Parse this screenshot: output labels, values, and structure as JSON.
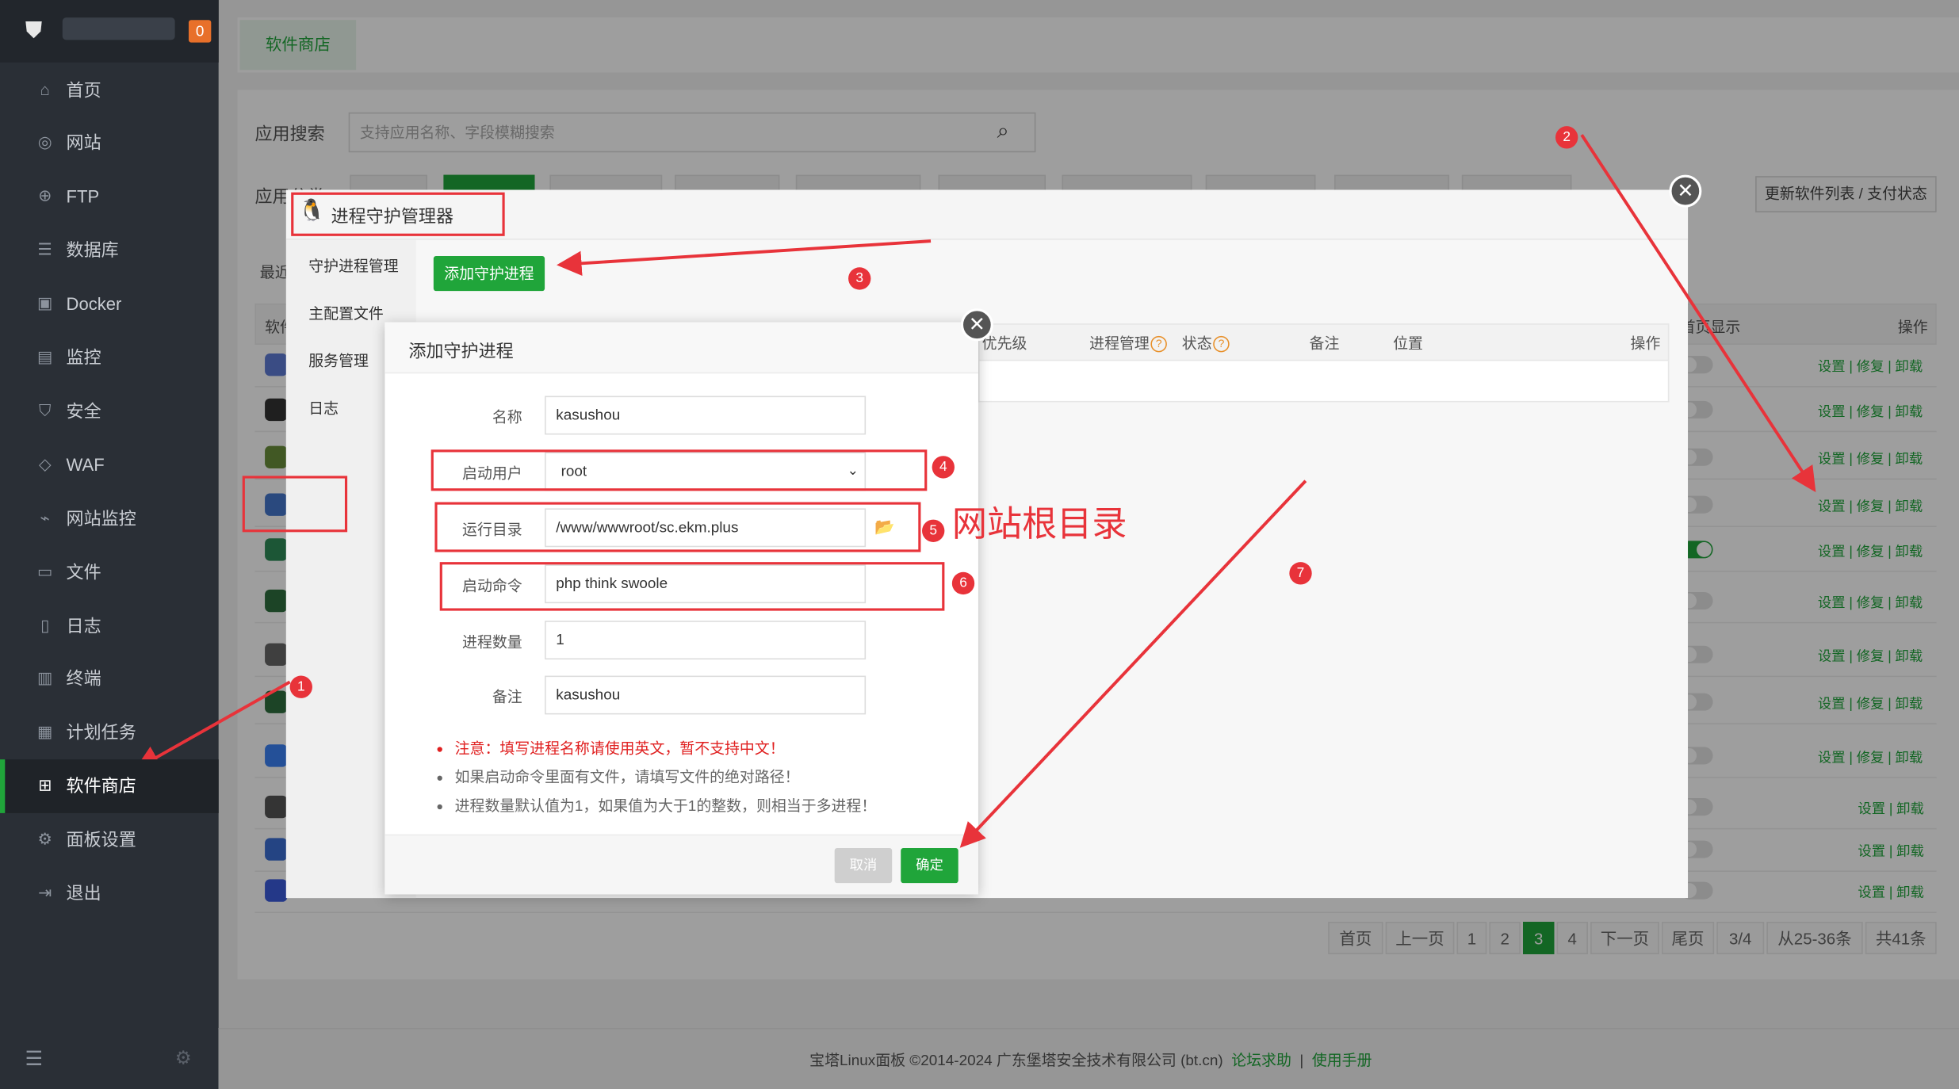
{
  "sidebar": {
    "badge": "0",
    "items": [
      {
        "label": "首页",
        "icon": "home-icon",
        "glyph": "⌂"
      },
      {
        "label": "网站",
        "icon": "globe-icon",
        "glyph": "◎"
      },
      {
        "label": "FTP",
        "icon": "ftp-icon",
        "glyph": "⊕"
      },
      {
        "label": "数据库",
        "icon": "database-icon",
        "glyph": "☰"
      },
      {
        "label": "Docker",
        "icon": "docker-icon",
        "glyph": "▣"
      },
      {
        "label": "监控",
        "icon": "monitor-icon",
        "glyph": "▤"
      },
      {
        "label": "安全",
        "icon": "shield-icon",
        "glyph": "⛉"
      },
      {
        "label": "WAF",
        "icon": "waf-icon",
        "glyph": "◇"
      },
      {
        "label": "网站监控",
        "icon": "chart-icon",
        "glyph": "⌁"
      },
      {
        "label": "文件",
        "icon": "folder-icon",
        "glyph": "▭"
      },
      {
        "label": "日志",
        "icon": "log-icon",
        "glyph": "▯"
      },
      {
        "label": "终端",
        "icon": "terminal-icon",
        "glyph": "▥"
      },
      {
        "label": "计划任务",
        "icon": "calendar-icon",
        "glyph": "▦"
      },
      {
        "label": "软件商店",
        "icon": "apps-icon",
        "glyph": "⊞"
      },
      {
        "label": "面板设置",
        "icon": "settings-icon",
        "glyph": "⚙"
      },
      {
        "label": "退出",
        "icon": "logout-icon",
        "glyph": "⇥"
      }
    ]
  },
  "tabs": {
    "active": "软件商店"
  },
  "search": {
    "label": "应用搜索",
    "placeholder": "支持应用名称、字段模糊搜索"
  },
  "category_label": "应用分类",
  "recent_label": "最近",
  "software_label": "软件",
  "update_button": "更新软件列表 / 支付状态",
  "table_headers": {
    "show": "首页显示",
    "ops": "操作"
  },
  "row_ops": {
    "full": "设置 | 修复 | 卸载",
    "short": "设置 | 卸载"
  },
  "pagination": {
    "first": "首页",
    "prev": "上一页",
    "p1": "1",
    "p2": "2",
    "p3": "3",
    "p4": "4",
    "next": "下一页",
    "last": "尾页",
    "ratio": "3/4",
    "range": "从25-36条",
    "total": "共41条"
  },
  "footer": {
    "copyright": "宝塔Linux面板 ©2014-2024 广东堡塔安全技术有限公司 (bt.cn)",
    "forum": "论坛求助",
    "sep": "|",
    "manual": "使用手册"
  },
  "pm_dialog": {
    "title": "进程守护管理器",
    "nav": [
      "守护进程管理",
      "主配置文件",
      "服务管理",
      "日志"
    ],
    "add_button": "添加守护进程",
    "columns": {
      "priority": "优先级",
      "proc_mgmt": "进程管理",
      "status": "状态",
      "remark": "备注",
      "location": "位置",
      "ops": "操作"
    }
  },
  "add_dialog": {
    "title": "添加守护进程",
    "fields": {
      "name": {
        "label": "名称",
        "value": "kasushou"
      },
      "user": {
        "label": "启动用户",
        "value": "root"
      },
      "dir": {
        "label": "运行目录",
        "value": "/www/wwwroot/sc.ekm.plus"
      },
      "cmd": {
        "label": "启动命令",
        "value": "php think swoole"
      },
      "count": {
        "label": "进程数量",
        "value": "1"
      },
      "remark": {
        "label": "备注",
        "value": "kasushou"
      }
    },
    "notes": [
      "注意：填写进程名称请使用英文，暂不支持中文！",
      "如果启动命令里面有文件，请填写文件的绝对路径！",
      "进程数量默认值为1，如果值为大于1的整数，则相当于多进程！"
    ],
    "cancel": "取消",
    "ok": "确定"
  },
  "annotations": {
    "n1": "1",
    "n2": "2",
    "n3": "3",
    "n4": "4",
    "n5": "5",
    "n6": "6",
    "n7": "7",
    "site_root": "网站根目录"
  },
  "colors": {
    "accent": "#20a53a",
    "annotation": "#e8333a",
    "sidebar": "#2a2f36"
  }
}
